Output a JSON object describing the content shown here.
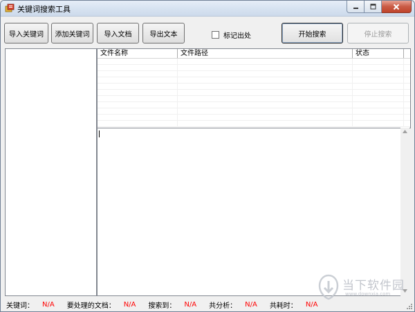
{
  "window": {
    "title": "关键词搜索工具",
    "icon": "app-icon",
    "controls": [
      "minimize-icon",
      "maximize-icon",
      "close-icon"
    ]
  },
  "toolbar": {
    "import_keywords": "导入关键词",
    "add_keyword": "添加关键词",
    "import_document": "导入文档",
    "export_text": "导出文本",
    "mark_location_label": "标记出处",
    "mark_location_checked": false,
    "start_search": "开始搜索",
    "stop_search": "停止搜索"
  },
  "file_list": {
    "columns": [
      "文件名称",
      "文件路径",
      "状态"
    ],
    "rows": []
  },
  "status": {
    "keywords_label": "关键词：",
    "keywords_value": "N/A",
    "docs_label": "要处理的文档：",
    "docs_value": "N/A",
    "found_label": "搜索到：",
    "found_value": "N/A",
    "analyzed_label": "共分析：",
    "analyzed_value": "N/A",
    "elapsed_label": "共耗时：",
    "elapsed_value": "N/A"
  },
  "watermark": {
    "title": "当下软件园",
    "url": "www.downxia.com"
  },
  "colors": {
    "status_value": "#ff0000",
    "titlebar": "#d5e1f0",
    "close_button": "#c95c45"
  }
}
